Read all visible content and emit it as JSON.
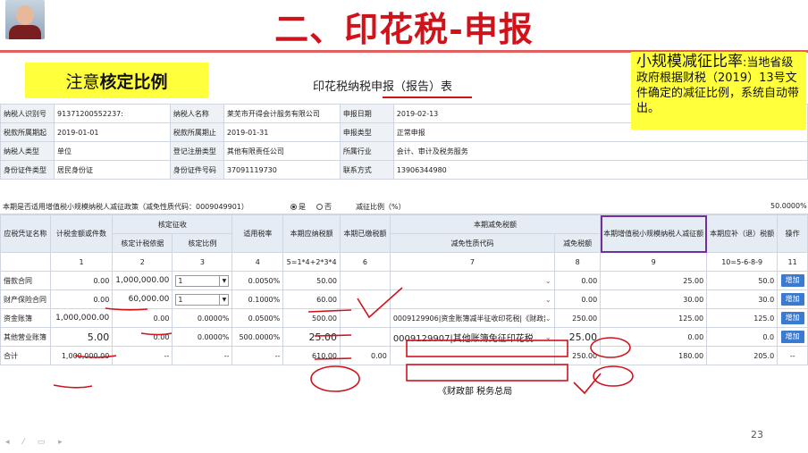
{
  "slide": {
    "title": "二、印花税-申报",
    "note": "注意核定比例",
    "note_plain": "注意",
    "note_bold": "核定比例",
    "info_big": "小规模减征比率",
    "info_rest": ":当地省级政府根据财税（2019）13号文件确定的减征比例，系统自动带出。",
    "page_number": "23"
  },
  "form": {
    "title": "印花税纳税申报（报告）表",
    "info_rows": [
      [
        "纳税人识别号",
        "91371200552237:",
        "纳税人名称",
        "莱芜市开得会计服务有限公司",
        "申报日期",
        "2019-02-13"
      ],
      [
        "税款所属期起",
        "2019-01-01",
        "税款所属期止",
        "2019-01-31",
        "申报类型",
        "正常申报"
      ],
      [
        "纳税人类型",
        "单位",
        "登记注册类型",
        "其他有限责任公司",
        "所属行业",
        "会计、审计及税务服务"
      ],
      [
        "身份证件类型",
        "居民身份证",
        "身份证件号码",
        "37091119730",
        "联系方式",
        "13906344980"
      ]
    ],
    "relief_question": "本期是否适用增值税小规模纳税人减征政策（减免性质代码：0009049901）",
    "yes": "是",
    "no": "否",
    "rate_label": "减征比例（%）",
    "rate_value": "50.0000%"
  },
  "table": {
    "headers": {
      "col1": "应税凭证名称",
      "col2": "计税金额或件数",
      "group_assessed": "核定征收",
      "col3": "核定计税依据",
      "col4": "核定比例",
      "col5": "适用税率",
      "col6": "本期应纳税额",
      "col7": "本期已缴税额",
      "group_relief": "本期减免税额",
      "col8": "减免性质代码",
      "col9": "减免税额",
      "col10": "本期增值税小规模纳税人减征额",
      "col11": "本期应补（退）税额",
      "col12": "操作"
    },
    "index_row": [
      "1",
      "2",
      "3",
      "4",
      "5=1*4+2*3*4",
      "6",
      "7",
      "8",
      "9",
      "10=5-6-8-9",
      "11"
    ],
    "rows": [
      {
        "name": "借款合同",
        "amount": "0.00",
        "basis": "1,000,000.00",
        "ratio": "1",
        "rate": "0.0050%",
        "due": "50.00",
        "paid": "",
        "code": "",
        "relief": "0.00",
        "small": "25.00",
        "payable": "50.0",
        "action": "增加"
      },
      {
        "name": "财产保险合同",
        "amount": "0.00",
        "basis": "60,000.00",
        "ratio": "1",
        "rate": "0.1000%",
        "due": "60.00",
        "paid": "",
        "code": "",
        "relief": "0.00",
        "small": "30.00",
        "payable": "30.0",
        "action": "增加"
      },
      {
        "name": "资金账簿",
        "amount": "1,000,000.00",
        "basis": "0.00",
        "ratio": "0.0000%",
        "rate": "0.0500%",
        "due": "500.00",
        "paid": "",
        "code": "0009129906|资金账簿减半征收印花税|《财政部",
        "relief": "250.00",
        "small": "125.00",
        "payable": "125.0",
        "action": "增加"
      },
      {
        "name": "其他营业账簿",
        "amount": "5.00",
        "basis": "0.00",
        "ratio": "0.0000%",
        "rate": "500.0000%",
        "due": "25.00",
        "paid": "",
        "code": "0009129907|其他账簿免征印花税",
        "relief": "25.00",
        "small": "0.00",
        "payable": "0.0",
        "action": "增加"
      }
    ],
    "total": {
      "name": "合计",
      "amount": "1,000,000.00",
      "basis": "--",
      "ratio": "--",
      "rate": "--",
      "due": "610.00",
      "paid": "0.00",
      "code": "--",
      "relief": "250.00",
      "small": "180.00",
      "payable": "205.0",
      "action": "--"
    },
    "caption_fragment": "《财政部 税务总局"
  },
  "colors": {
    "title_red": "#d0121b",
    "highlight_yellow": "#ffff3c",
    "purple_box": "#7030a0",
    "button_blue": "#3a7ad1"
  }
}
